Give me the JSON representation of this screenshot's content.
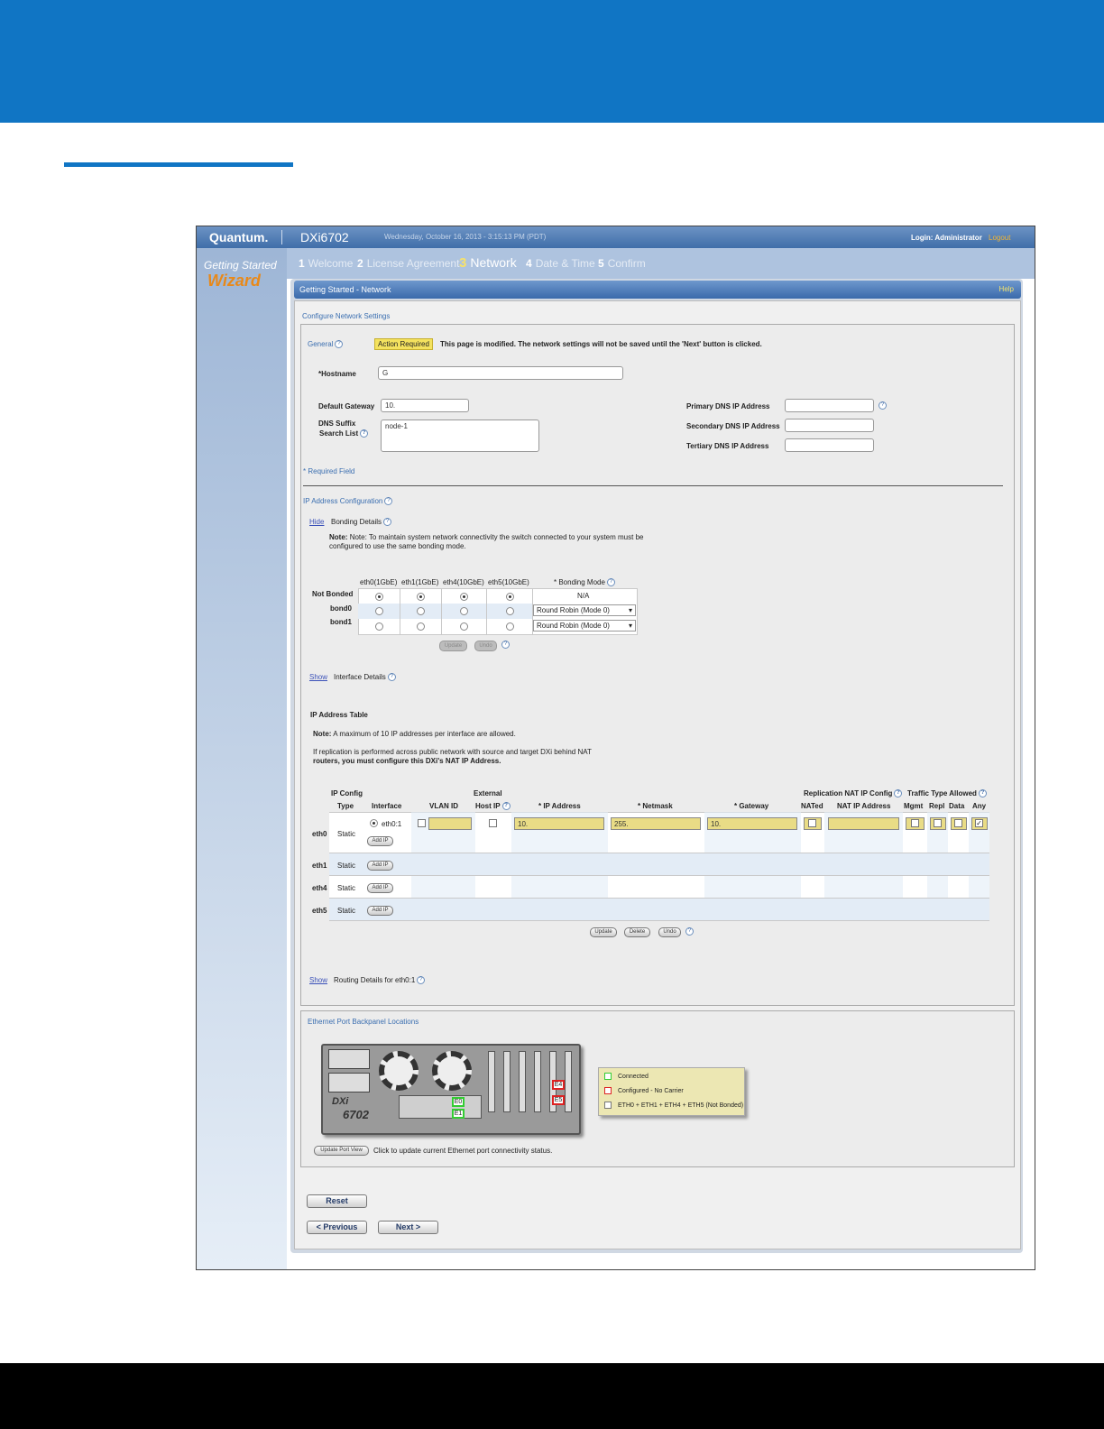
{
  "app": {
    "logo": "Quantum.",
    "model": "DXi6702",
    "datetime": "Wednesday, October 16, 2013 - 3:15:13 PM (PDT)",
    "login": "Login: Administrator",
    "logout": "Logout"
  },
  "sidebar": {
    "line1": "Getting Started",
    "line2": "Wizard"
  },
  "steps": [
    {
      "num": "1",
      "label": "Welcome"
    },
    {
      "num": "2",
      "label": "License Agreement"
    },
    {
      "num": "3",
      "label": "Network"
    },
    {
      "num": "4",
      "label": "Date & Time"
    },
    {
      "num": "5",
      "label": "Confirm"
    }
  ],
  "panel": {
    "title": "Getting Started - Network",
    "help": "Help"
  },
  "config": {
    "section": "Configure Network Settings",
    "general": "General",
    "badge": "Action Required",
    "notice": "This page is modified. The network settings will not be saved until the 'Next' button is clicked.",
    "hostname_label": "*Hostname",
    "hostname_value": "G",
    "gateway_label": "Default Gateway",
    "gateway_value": "10.",
    "dns_suffix_label1": "DNS Suffix",
    "dns_suffix_label2": "Search List",
    "dns_suffix_value": "node-1",
    "primary_dns": "Primary DNS IP Address",
    "secondary_dns": "Secondary DNS IP Address",
    "tertiary_dns": "Tertiary DNS IP Address",
    "required": "*  Required Field"
  },
  "ipconfig": {
    "title": "IP Address Configuration",
    "hide": "Hide",
    "bonding_title": "Bonding Details",
    "bonding_note1": "Note: To maintain system network connectivity the switch connected to your system must be",
    "bonding_note2": "configured to use the same bonding mode.",
    "columns": [
      "eth0(1GbE)",
      "eth1(1GbE)",
      "eth4(10GbE)",
      "eth5(10GbE)"
    ],
    "mode_header": "*  Bonding Mode",
    "rows": [
      {
        "label": "Not Bonded",
        "mode": "N/A"
      },
      {
        "label": "bond0",
        "mode": "Round Robin (Mode 0)"
      },
      {
        "label": "bond1",
        "mode": "Round Robin (Mode 0)"
      }
    ],
    "update": "Update",
    "undo": "Undo",
    "show": "Show",
    "interface_title": "Interface Details",
    "table_title": "IP Address Table",
    "note_label": "Note:",
    "note1": "A maximum of 10 IP addresses per interface are allowed.",
    "note2": "If replication is performed across public network with source and target DXi behind NAT",
    "note3": "routers, you must configure this DXi's NAT IP Address."
  },
  "iptable": {
    "headers": {
      "ip_config": "IP Config",
      "type": "Type",
      "interface": "Interface",
      "vlan": "VLAN ID",
      "external": "External",
      "host_ip": "Host IP",
      "ip": "*  IP Address",
      "netmask": "*  Netmask",
      "gateway": "*  Gateway",
      "repl_nat": "Replication NAT IP Config",
      "nated": "NATed",
      "nat_ip": "NAT IP Address",
      "traffic": "Traffic Type Allowed",
      "mgmt": "Mgmt",
      "repl": "Repl",
      "data": "Data",
      "any": "Any"
    },
    "rows": [
      {
        "name": "eth0",
        "type": "Static",
        "iface": "eth0:1",
        "ip": "10.",
        "netmask": "255.",
        "gateway": "10."
      },
      {
        "name": "eth1",
        "type": "Static"
      },
      {
        "name": "eth4",
        "type": "Static"
      },
      {
        "name": "eth5",
        "type": "Static"
      }
    ],
    "add_ip": "Add IP",
    "update": "Update",
    "delete": "Delete",
    "undo": "Undo",
    "show": "Show",
    "routing": "Routing Details for eth0:1"
  },
  "backpanel": {
    "title": "Ethernet Port Backpanel Locations",
    "model_line1": "DXi",
    "model_line2": "6702",
    "ports": [
      "E0",
      "E1",
      "E4",
      "E5"
    ],
    "legend": [
      {
        "label": "Connected",
        "color": "#33cc33"
      },
      {
        "label": "Configured - No Carrier",
        "color": "#dd2222"
      },
      {
        "label": "ETH0 + ETH1 + ETH4 + ETH5  (Not Bonded)",
        "color": "#ffffff"
      }
    ],
    "update_btn": "Update Port View",
    "update_text": "Click to update current Ethernet port connectivity status."
  },
  "buttons": {
    "reset": "Reset",
    "previous": "< Previous",
    "next": "Next >"
  }
}
